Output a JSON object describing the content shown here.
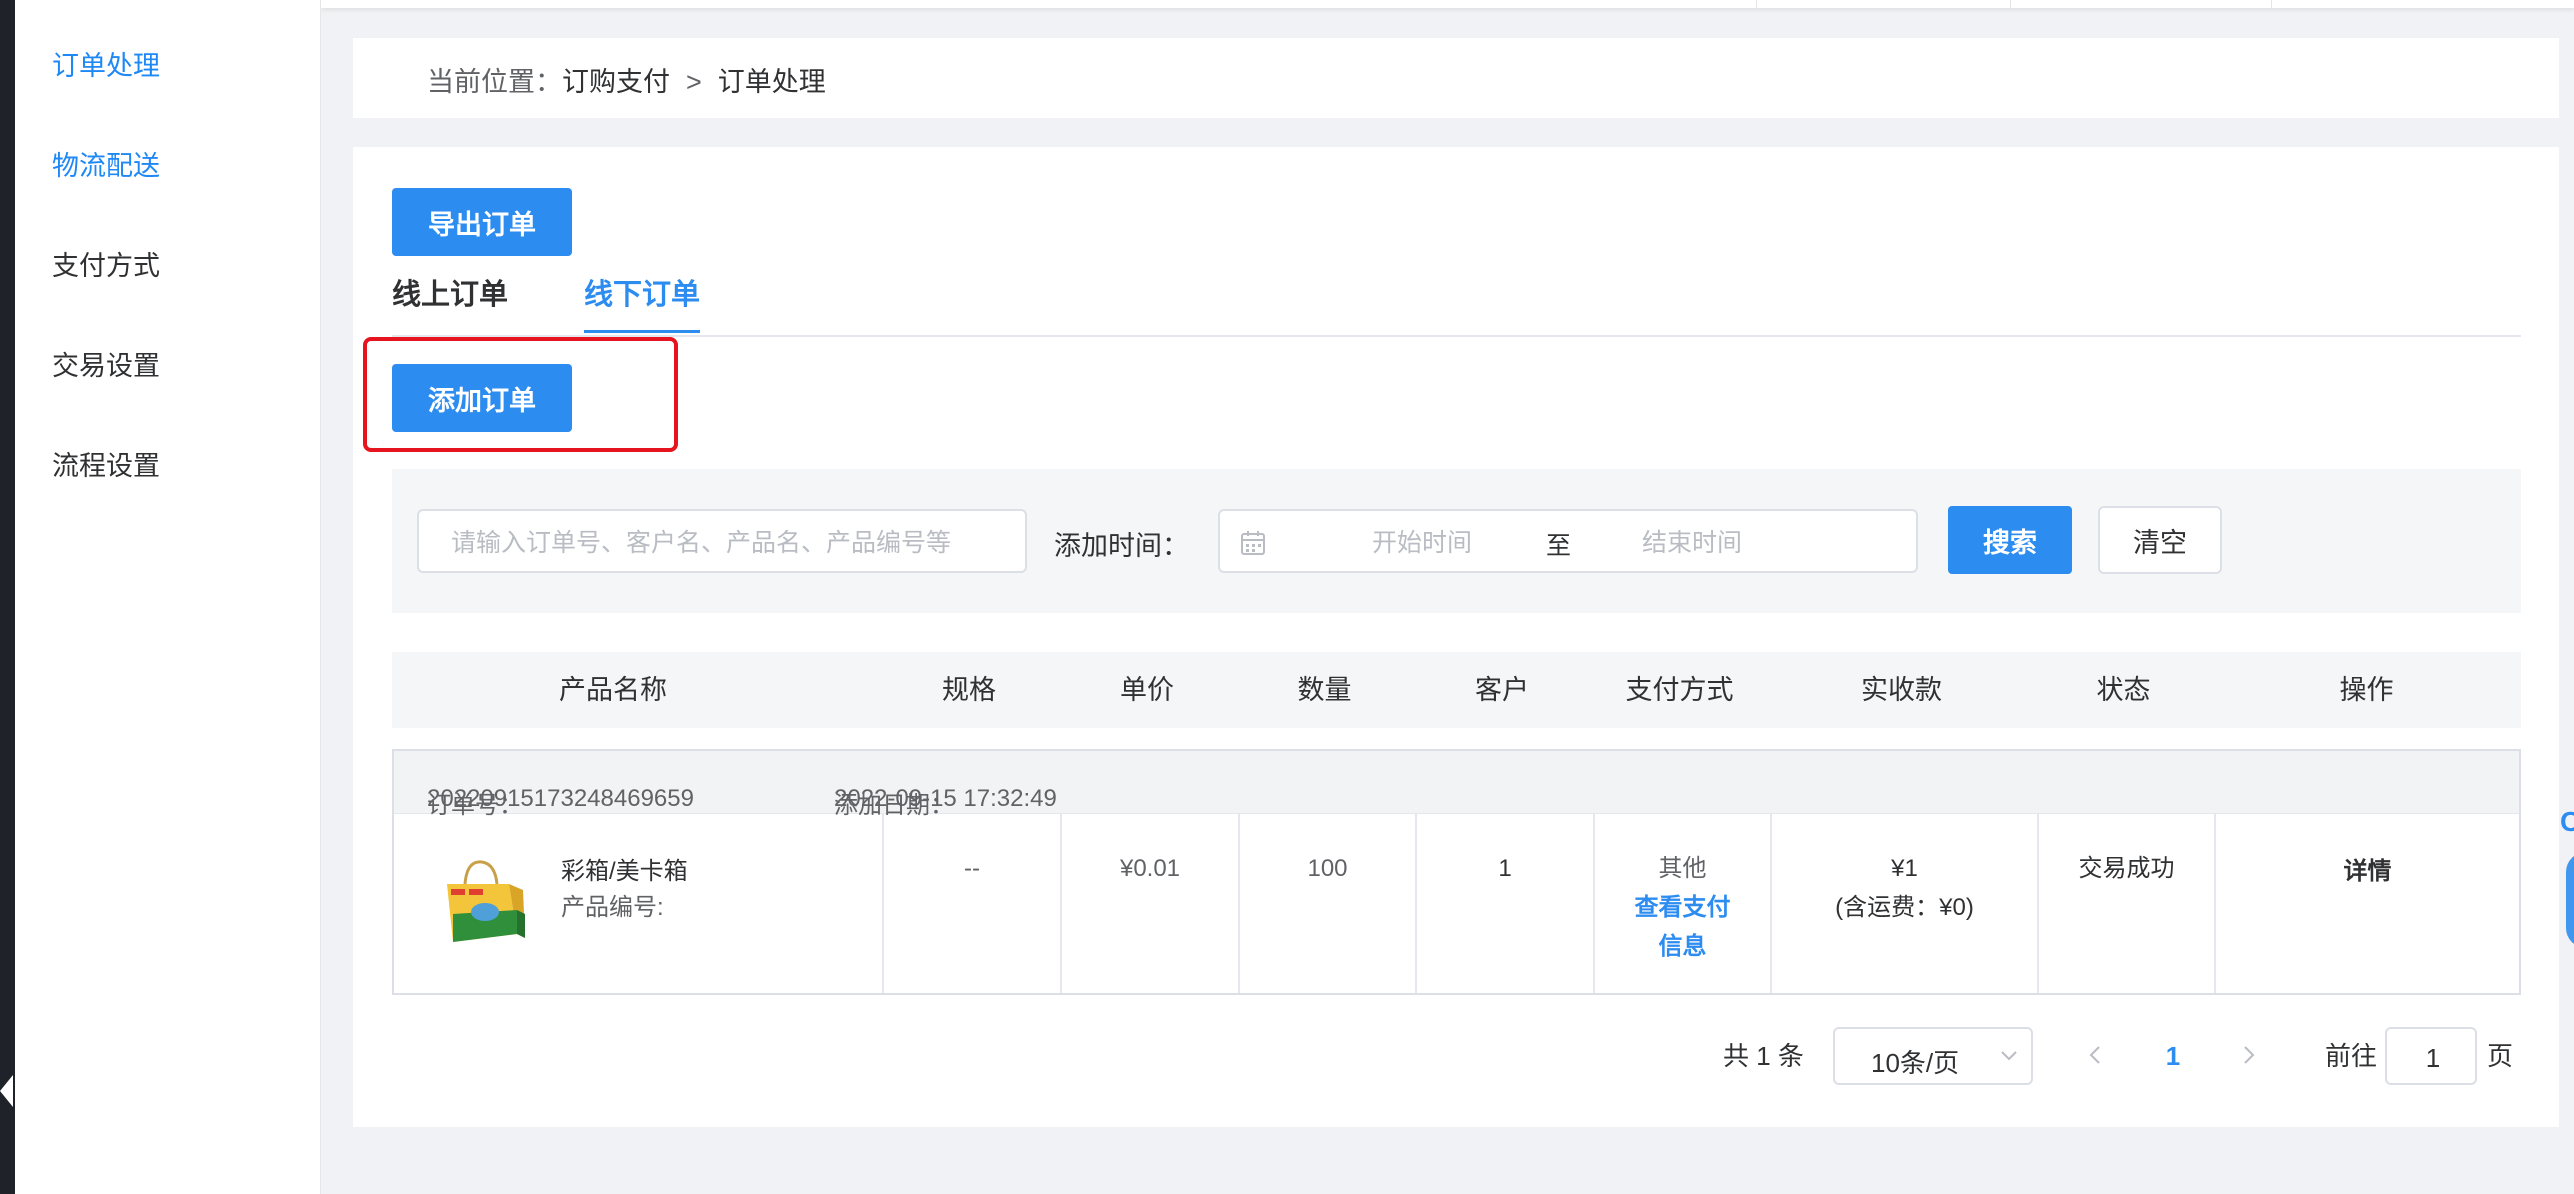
{
  "sidebar": {
    "items": [
      {
        "label": "订单处理",
        "active": true
      },
      {
        "label": "物流配送",
        "active": true
      },
      {
        "label": "支付方式",
        "active": false
      },
      {
        "label": "交易设置",
        "active": false
      },
      {
        "label": "流程设置",
        "active": false
      }
    ]
  },
  "breadcrumb": {
    "prefix": "当前位置：",
    "parent": "订购支付",
    "separator": ">",
    "current": "订单处理"
  },
  "toolbar": {
    "export_label": "导出订单",
    "add_label": "添加订单"
  },
  "tabs": [
    {
      "label": "线上订单",
      "active": false
    },
    {
      "label": "线下订单",
      "active": true
    }
  ],
  "filter": {
    "search_placeholder": "请输入订单号、客户名、产品名、产品编号等",
    "date_label": "添加时间：",
    "start_placeholder": "开始时间",
    "range_separator": "至",
    "end_placeholder": "结束时间",
    "search_button": "搜索",
    "clear_button": "清空"
  },
  "table": {
    "columns": [
      "产品名称",
      "规格",
      "单价",
      "数量",
      "客户",
      "支付方式",
      "实收款",
      "状态",
      "操作"
    ],
    "orders": [
      {
        "order_no_label": "订单号：",
        "order_no": "20220915173248469659",
        "date_label": "添加日期：",
        "date": "2022-09-15 17:32:49",
        "product_name": "彩箱/美卡箱",
        "product_code_label": "产品编号:",
        "spec": "--",
        "unit_price": "¥0.01",
        "quantity": "100",
        "customer": "1",
        "payment_method": "其他",
        "payment_link_line1": "查看支付",
        "payment_link_line2": "信息",
        "amount": "¥1",
        "shipping": "(含运费：¥0)",
        "status": "交易成功",
        "action": "详情"
      }
    ]
  },
  "pagination": {
    "total_text": "共 1 条",
    "page_size": "10条/页",
    "current_page": "1",
    "goto_label": "前往",
    "goto_value": "1",
    "page_unit": "页"
  },
  "colors": {
    "primary": "#2d8cf0",
    "highlight_border": "#e5141e",
    "sidebar_active": "#1e88f5"
  }
}
